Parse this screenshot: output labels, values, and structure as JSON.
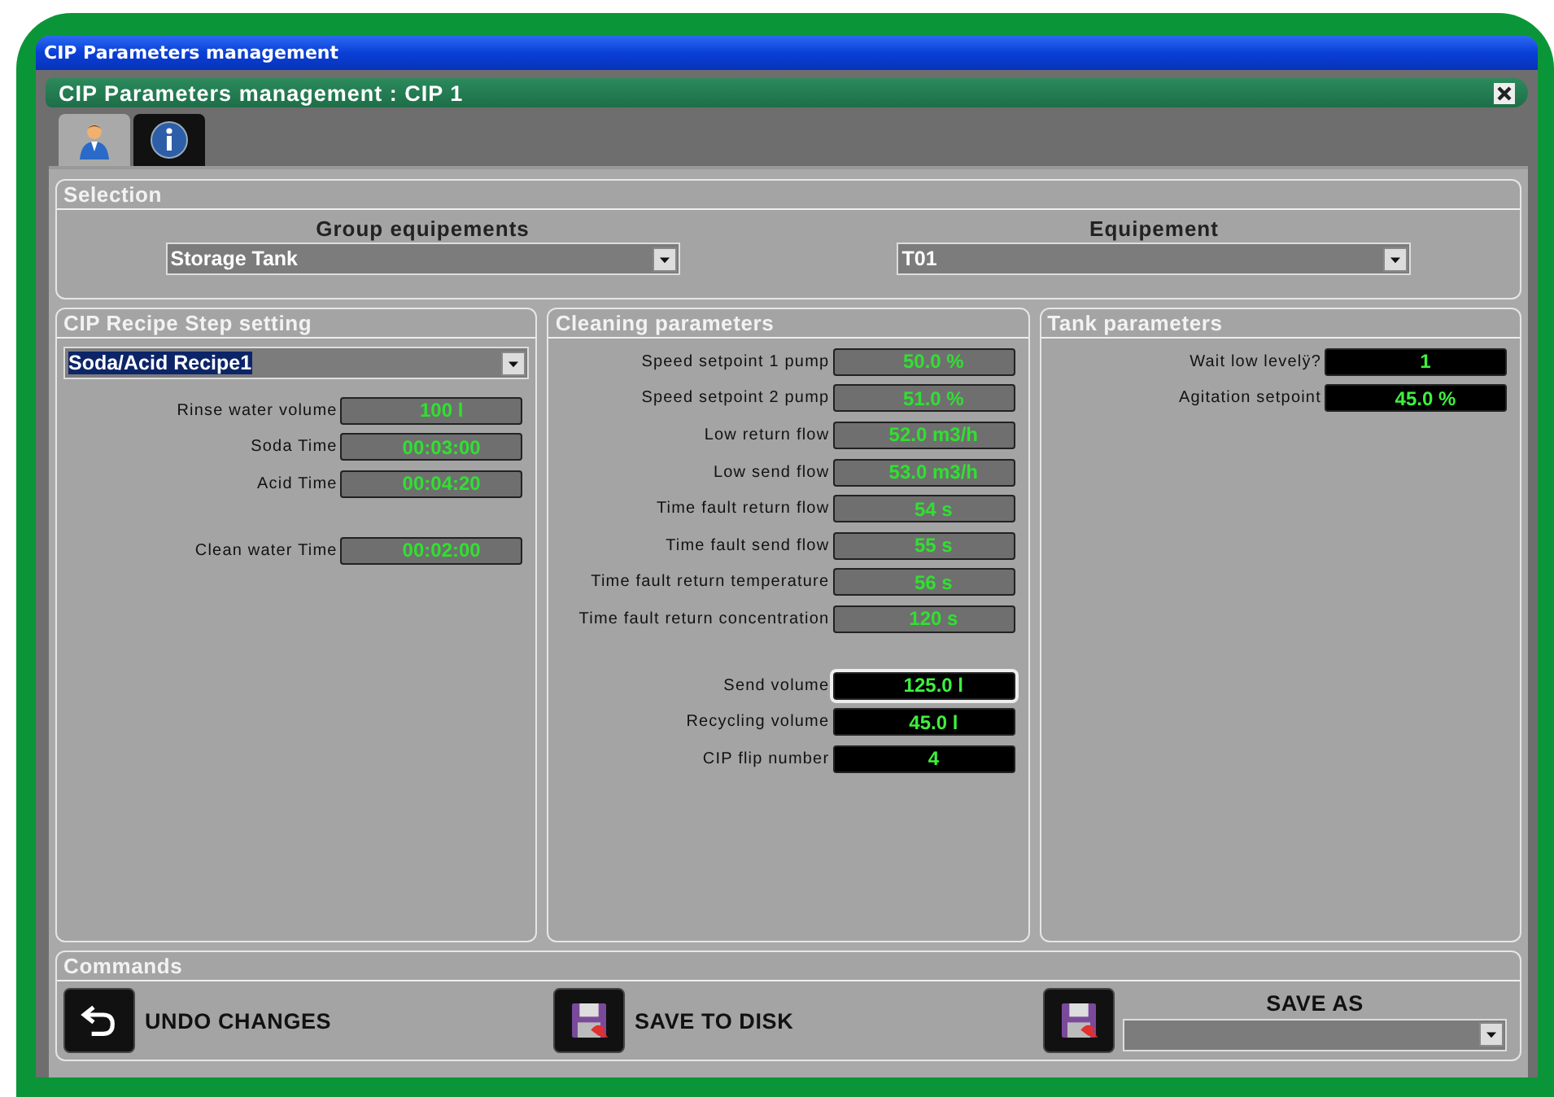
{
  "window": {
    "title": "CIP Parameters management"
  },
  "header": {
    "title": "CIP Parameters management : CIP 1"
  },
  "tabs": [
    {
      "kind": "user",
      "selected": true
    },
    {
      "kind": "info",
      "selected": false
    }
  ],
  "selection": {
    "title": "Selection",
    "fields": [
      {
        "label": "Group equipements",
        "value": "Storage Tank"
      },
      {
        "label": "Equipement",
        "value": "T01"
      }
    ]
  },
  "panels": [
    {
      "title": "CIP Recipe Step setting",
      "recipe": "Soda/Acid Recipe1",
      "groups": [
        [
          {
            "label": "Rinse water volume",
            "value": "100 l",
            "kind": "editable",
            "focused": false
          },
          {
            "label": "Soda Time",
            "value": "00:03:00",
            "kind": "editable",
            "focused": false
          },
          {
            "label": "Acid Time",
            "value": "00:04:20",
            "kind": "editable",
            "focused": false
          }
        ],
        [
          {
            "label": "Clean water Time",
            "value": "00:02:00",
            "kind": "editable",
            "focused": false
          }
        ]
      ]
    },
    {
      "title": "Cleaning parameters",
      "groups": [
        [
          {
            "label": "Speed setpoint 1 pump",
            "value": "50.0 %",
            "kind": "editable",
            "focused": false
          },
          {
            "label": "Speed setpoint 2 pump",
            "value": "51.0 %",
            "kind": "editable",
            "focused": false
          },
          {
            "label": "Low return flow",
            "value": "52.0 m3/h",
            "kind": "editable",
            "focused": false
          },
          {
            "label": "Low send flow",
            "value": "53.0 m3/h",
            "kind": "editable",
            "focused": false
          },
          {
            "label": "Time fault return flow",
            "value": "54 s",
            "kind": "editable",
            "focused": false
          },
          {
            "label": "Time fault send flow",
            "value": "55 s",
            "kind": "editable",
            "focused": false
          },
          {
            "label": "Time fault return temperature",
            "value": "56 s",
            "kind": "editable",
            "focused": false
          },
          {
            "label": "Time fault return concentration",
            "value": "120 s",
            "kind": "editable",
            "focused": false
          }
        ],
        [
          {
            "label": "Send volume",
            "value": "125.0 l",
            "kind": "readonly",
            "focused": true
          },
          {
            "label": "Recycling volume",
            "value": "45.0 l",
            "kind": "readonly",
            "focused": false
          },
          {
            "label": "CIP flip number",
            "value": "4",
            "kind": "readonly",
            "focused": false
          }
        ]
      ]
    },
    {
      "title": "Tank parameters",
      "groups": [
        [
          {
            "label": "Wait low levelÿ?",
            "value": "1",
            "kind": "readonly",
            "focused": false
          },
          {
            "label": "Agitation setpoint",
            "value": "45.0 %",
            "kind": "readonly",
            "focused": false
          }
        ]
      ]
    }
  ],
  "commands": {
    "title": "Commands",
    "buttons": [
      {
        "kind": "undo",
        "label": "UNDO CHANGES"
      },
      {
        "kind": "save",
        "label": "SAVE TO DISK"
      }
    ],
    "save_as": {
      "kind": "save",
      "label": "SAVE AS"
    }
  }
}
